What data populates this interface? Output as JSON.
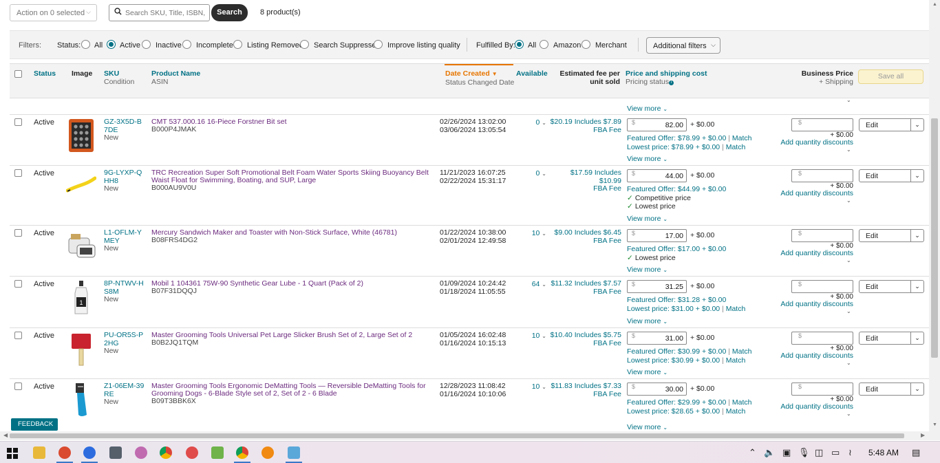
{
  "toolbar": {
    "action_label": "Action on 0 selected",
    "search_placeholder": "Search SKU, Title, ISBN, ASIN",
    "search_button": "Search",
    "product_count": "8 product(s)"
  },
  "filters": {
    "label": "Filters:",
    "status_label": "Status:",
    "status_options": [
      "All",
      "Active",
      "Inactive",
      "Incomplete",
      "Listing Removed",
      "Search Suppressed",
      "Improve listing quality"
    ],
    "status_selected": "Active",
    "fulfilled_label": "Fulfilled By:",
    "fulfilled_options": [
      "All",
      "Amazon",
      "Merchant"
    ],
    "fulfilled_selected": "All",
    "additional_filters": "Additional filters"
  },
  "table_header": {
    "status": "Status",
    "image": "Image",
    "sku": "SKU",
    "condition": "Condition",
    "product_name": "Product Name",
    "asin": "ASIN",
    "date_created": "Date Created",
    "status_changed_date": "Status Changed Date",
    "available": "Available",
    "fee_line1": "Estimated fee per",
    "fee_line2": "unit sold",
    "price_shipping": "Price and shipping cost",
    "pricing_status": "Pricing status",
    "business_price": "Business Price",
    "plus_shipping": "+ Shipping",
    "save_all": "Save all"
  },
  "common": {
    "view_more": "View more",
    "edit": "Edit",
    "ship_add": "+ $0.00",
    "add_qty": "Add quantity discounts",
    "dollar": "$",
    "match": "Match"
  },
  "rows": [
    {
      "status": "Active",
      "sku": "GZ-3X5D-B7DE",
      "condition": "New",
      "name": "CMT 537.000.16 16-Piece Forstner Bit set",
      "asin": "B000P4JMAK",
      "date_created": "02/26/2024 13:02:00",
      "status_changed": "03/06/2024 13:05:54",
      "available": "0",
      "fee": "$20.19 Includes $7.89",
      "fee_sub": "FBA Fee",
      "price": "82.00",
      "line1": "Featured Offer: $78.99 + $0.00",
      "line1_match": true,
      "line2": "Lowest price: $78.99 + $0.00",
      "line2_match": true,
      "checks": [],
      "image": "drillcase"
    },
    {
      "status": "Active",
      "sku": "9G-LYXP-QHH8",
      "condition": "New",
      "name": "TRC Recreation Super Soft Promotional Belt Foam Water Sports Skiing Buoyancy Belt Waist Float for Swimming, Boating, and SUP, Large",
      "asin": "B000AU9V0U",
      "date_created": "11/21/2023 16:07:25",
      "status_changed": "02/22/2024 15:31:17",
      "available": "0",
      "fee": "$17.59 Includes $10.99",
      "fee_sub": "FBA Fee",
      "price": "44.00",
      "line1": "Featured Offer: $44.99 + $0.00",
      "line1_match": false,
      "line2": "",
      "line2_match": false,
      "checks": [
        "Competitive price",
        "Lowest price"
      ],
      "image": "belt"
    },
    {
      "status": "Active",
      "sku": "L1-OFLM-YMEY",
      "condition": "New",
      "name": "Mercury Sandwich Maker and Toaster with Non-Stick Surface, White (46781)",
      "asin": "B08FRS4DG2",
      "date_created": "01/22/2024 10:38:00",
      "status_changed": "02/01/2024 12:49:58",
      "available": "10",
      "fee": "$9.00 Includes $6.45",
      "fee_sub": "FBA Fee",
      "price": "17.00",
      "line1": "Featured Offer: $17.00 + $0.00",
      "line1_match": false,
      "line2": "",
      "line2_match": false,
      "checks": [
        "Lowest price"
      ],
      "image": "sandwich"
    },
    {
      "status": "Active",
      "sku": "8P-NTWV-HS8M",
      "condition": "New",
      "name": "Mobil 1 104361 75W-90 Synthetic Gear Lube - 1 Quart (Pack of 2)",
      "asin": "B07F31DQQJ",
      "date_created": "01/09/2024 10:24:42",
      "status_changed": "01/18/2024 11:05:55",
      "available": "64",
      "fee": "$11.32 Includes $7.57",
      "fee_sub": "FBA Fee",
      "price": "31.25",
      "line1": "Featured Offer: $31.28 + $0.00",
      "line1_match": false,
      "line2": "Lowest price: $31.00 + $0.00",
      "line2_match": true,
      "checks": [],
      "image": "bottle"
    },
    {
      "status": "Active",
      "sku": "PU-OR5S-P2HG",
      "condition": "New",
      "name": "Master Grooming Tools Universal Pet Large Slicker Brush Set of 2, Large Set of 2",
      "asin": "B0B2JQ1TQM",
      "date_created": "01/05/2024 16:02:48",
      "status_changed": "01/16/2024 10:15:13",
      "available": "10",
      "fee": "$10.40 Includes $5.75",
      "fee_sub": "FBA Fee",
      "price": "31.00",
      "line1": "Featured Offer: $30.99 + $0.00",
      "line1_match": true,
      "line2": "Lowest price: $30.99 + $0.00",
      "line2_match": true,
      "checks": [],
      "image": "brush"
    },
    {
      "status": "Active",
      "sku": "Z1-06EM-39RE",
      "condition": "New",
      "name": "Master Grooming Tools Ergonomic DeMatting Tools — Reversible DeMatting Tools for Grooming Dogs - 6-Blade Style set of 2, Set of 2 - 6 Blade",
      "asin": "B09T3BBK6X",
      "date_created": "12/28/2023 11:08:42",
      "status_changed": "01/16/2024 10:10:06",
      "available": "10",
      "fee": "$11.83 Includes $7.33",
      "fee_sub": "FBA Fee",
      "price": "30.00",
      "line1": "Featured Offer: $29.99 + $0.00",
      "line1_match": true,
      "line2": "Lowest price: $28.65 + $0.00",
      "line2_match": true,
      "checks": [],
      "image": "dematting"
    }
  ],
  "feedback": "FEEDBACK",
  "taskbar": {
    "clock": "5:48 AM",
    "apps": [
      "file-explorer-icon",
      "wps-icon",
      "zoom-icon",
      "calculator-icon",
      "paint-icon",
      "chrome-icon",
      "photos-icon",
      "slack-icon",
      "chrome-profile-icon",
      "vlc-icon",
      "notepad-icon"
    ]
  },
  "colors": {
    "link": "#007185",
    "product": "#6b2a7e",
    "accent": "#e77600",
    "check": "#1a8a2e"
  }
}
